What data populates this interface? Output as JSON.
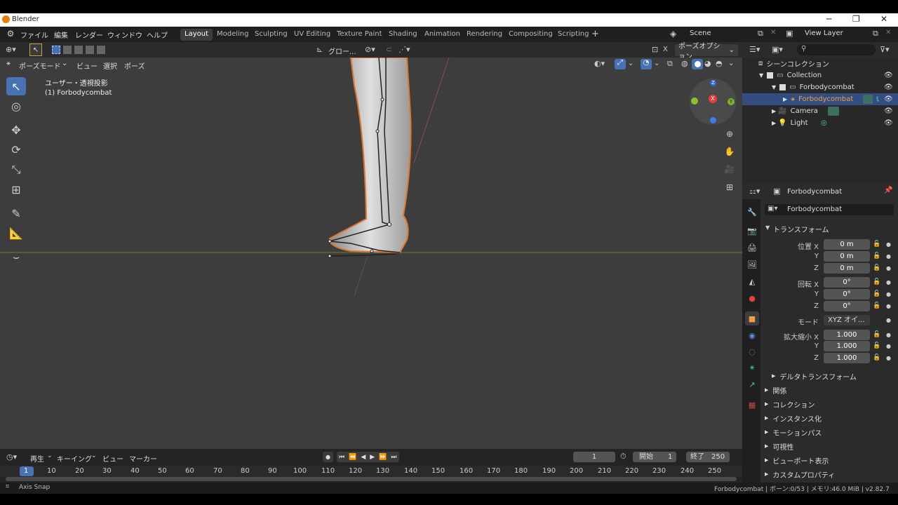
{
  "window": {
    "title": "Blender"
  },
  "menu": [
    "ファイル",
    "編集",
    "レンダー",
    "ウィンドウ",
    "ヘルプ"
  ],
  "workspaces": [
    "Layout",
    "Modeling",
    "Sculpting",
    "UV Editing",
    "Texture Paint",
    "Shading",
    "Animation",
    "Rendering",
    "Compositing",
    "Scripting"
  ],
  "active_workspace": "Layout",
  "scene": {
    "label": "Scene",
    "view_layer": "View Layer"
  },
  "viewport": {
    "mode": "ポーズモード",
    "menus": [
      "ビュー",
      "選択",
      "ポーズ"
    ],
    "transform_orientation": "グロー...",
    "pose_options": "ポーズオプション",
    "overlay_text_1": "ユーザー・透視投影",
    "overlay_text_2": "(1) Forbodycombat",
    "gizmo": {
      "x": "X",
      "y": "Y",
      "z": "Z"
    }
  },
  "outliner": {
    "search_placeholder": "",
    "root": "シーンコレクション",
    "items": [
      {
        "label": "Collection"
      },
      {
        "label": "Forbodycombat"
      },
      {
        "label": "Forbodycombat"
      },
      {
        "label": "Camera"
      },
      {
        "label": "Light"
      }
    ]
  },
  "properties": {
    "object_name": "Forbodycombat",
    "datablock": "Forbodycombat",
    "transform_header": "トランスフォーム",
    "location": {
      "label_x": "位置 X",
      "x": "0 m",
      "y": "0 m",
      "z": "0 m"
    },
    "rotation": {
      "label_x": "回転 X",
      "x": "0°",
      "y": "0°",
      "z": "0°"
    },
    "mode_label": "モード",
    "mode_value": "XYZ オイ...",
    "scale": {
      "label_x": "拡大縮小 X",
      "x": "1.000",
      "y": "1.000",
      "z": "1.000"
    },
    "axis_y": "Y",
    "axis_z": "Z",
    "delta": "デルタトランスフォーム",
    "panels": [
      "関係",
      "コレクション",
      "インスタンス化",
      "モーションパス",
      "可視性",
      "ビューポート表示",
      "カスタムプロパティ"
    ]
  },
  "timeline": {
    "menus": [
      "再生",
      "キーイング",
      "ビュー",
      "マーカー"
    ],
    "current_frame": "1",
    "start_label": "開始",
    "start": "1",
    "end_label": "終了",
    "end": "250",
    "ticks": [
      "1",
      "10",
      "20",
      "30",
      "40",
      "50",
      "60",
      "70",
      "80",
      "90",
      "100",
      "110",
      "120",
      "130",
      "140",
      "150",
      "160",
      "170",
      "180",
      "190",
      "200",
      "210",
      "220",
      "230",
      "240",
      "250"
    ]
  },
  "status": {
    "left": "Axis Snap",
    "right": "Forbodycombat | ボーン:0/53 | メモリ:46.0 MiB | v2.82.7"
  }
}
